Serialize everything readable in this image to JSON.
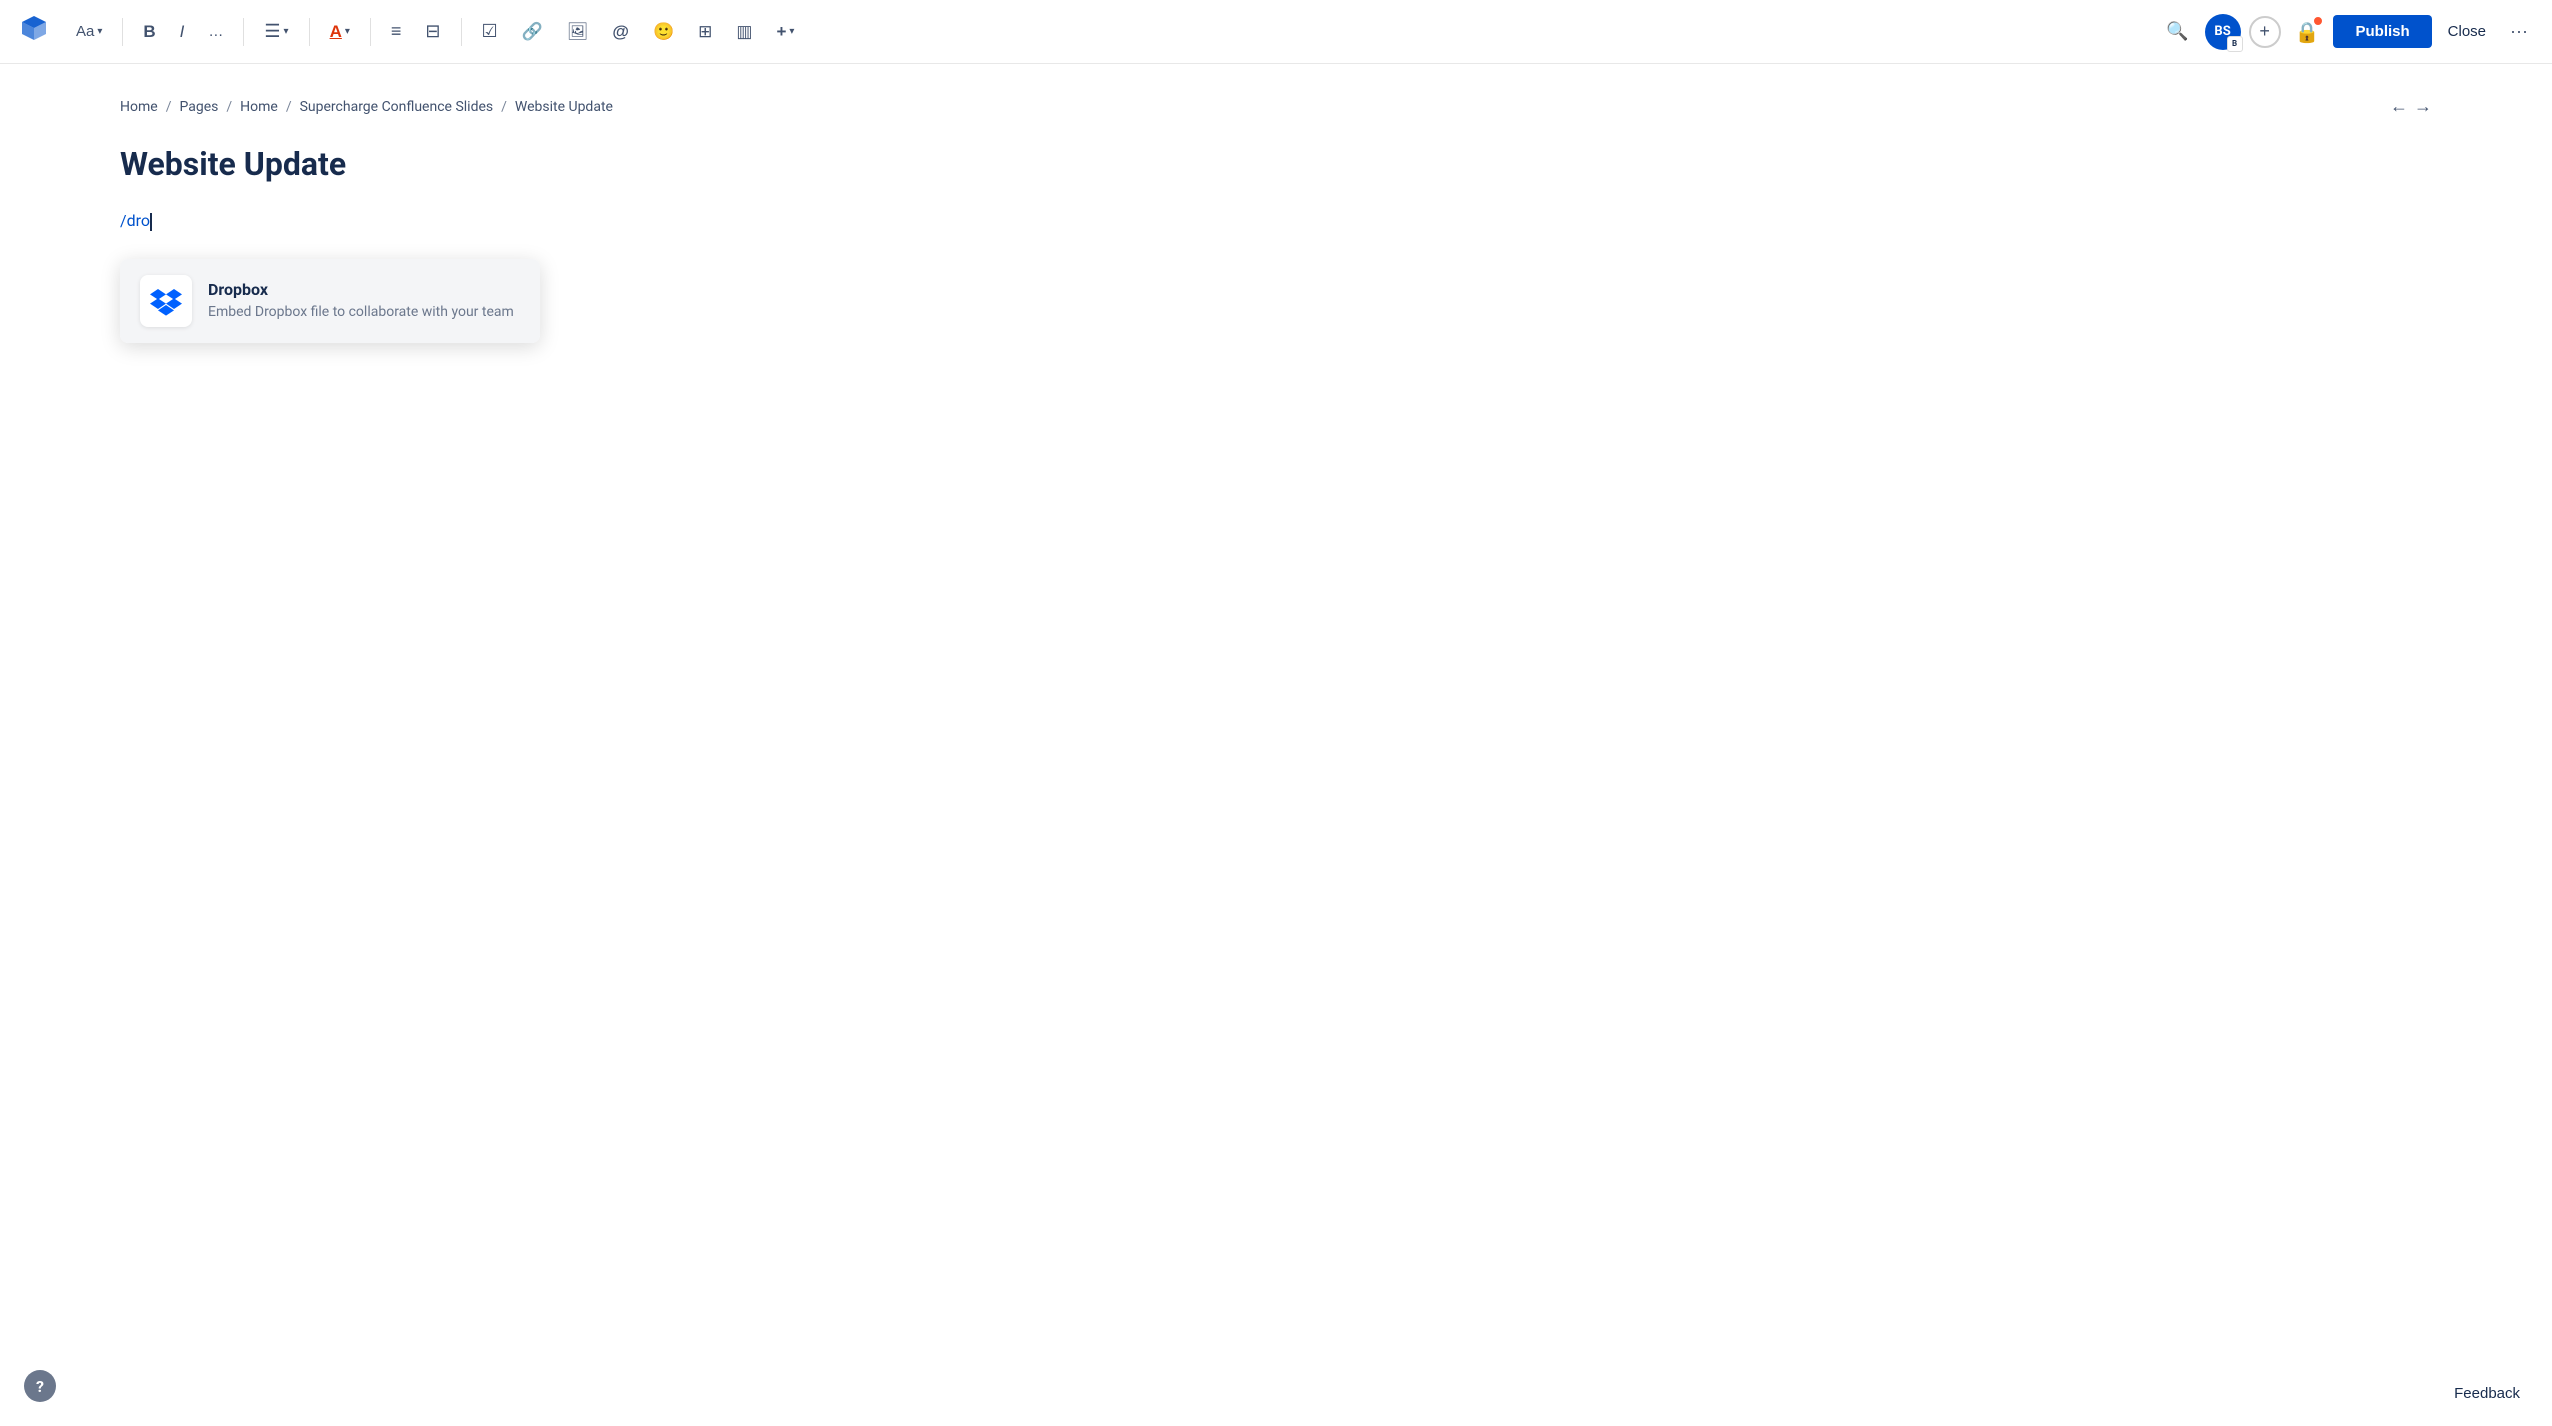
{
  "toolbar": {
    "text_style_label": "Aa",
    "text_style_arrow": "▾",
    "bold_label": "B",
    "italic_label": "I",
    "more_format_label": "…",
    "align_label": "≡",
    "align_arrow": "▾",
    "text_color_label": "A",
    "text_color_arrow": "▾",
    "bullet_label": "≡",
    "number_label": "≡",
    "checkbox_label": "☑",
    "link_label": "🔗",
    "image_label": "🖼",
    "mention_label": "@",
    "emoji_label": "😊",
    "table_label": "⊞",
    "layout_label": "⊟",
    "insert_label": "+",
    "insert_arrow": "▾",
    "search_label": "🔍",
    "avatar_initials": "BS",
    "avatar_badge": "B",
    "plus_label": "+",
    "publish_label": "Publish",
    "close_label": "Close",
    "more_options_label": "···"
  },
  "breadcrumb": {
    "items": [
      {
        "label": "Home",
        "href": "#"
      },
      {
        "label": "Pages",
        "href": "#"
      },
      {
        "label": "Home",
        "href": "#"
      },
      {
        "label": "Supercharge Confluence Slides",
        "href": "#"
      },
      {
        "label": "Website Update",
        "href": "#"
      }
    ],
    "nav_left": "←",
    "nav_right": "→"
  },
  "page": {
    "title": "Website Update",
    "slash_command": "/dro"
  },
  "dropdown": {
    "items": [
      {
        "title": "Dropbox",
        "description": "Embed Dropbox file to collaborate with your team",
        "icon": "dropbox"
      }
    ]
  },
  "help": {
    "label": "?"
  },
  "feedback": {
    "label": "Feedback"
  }
}
